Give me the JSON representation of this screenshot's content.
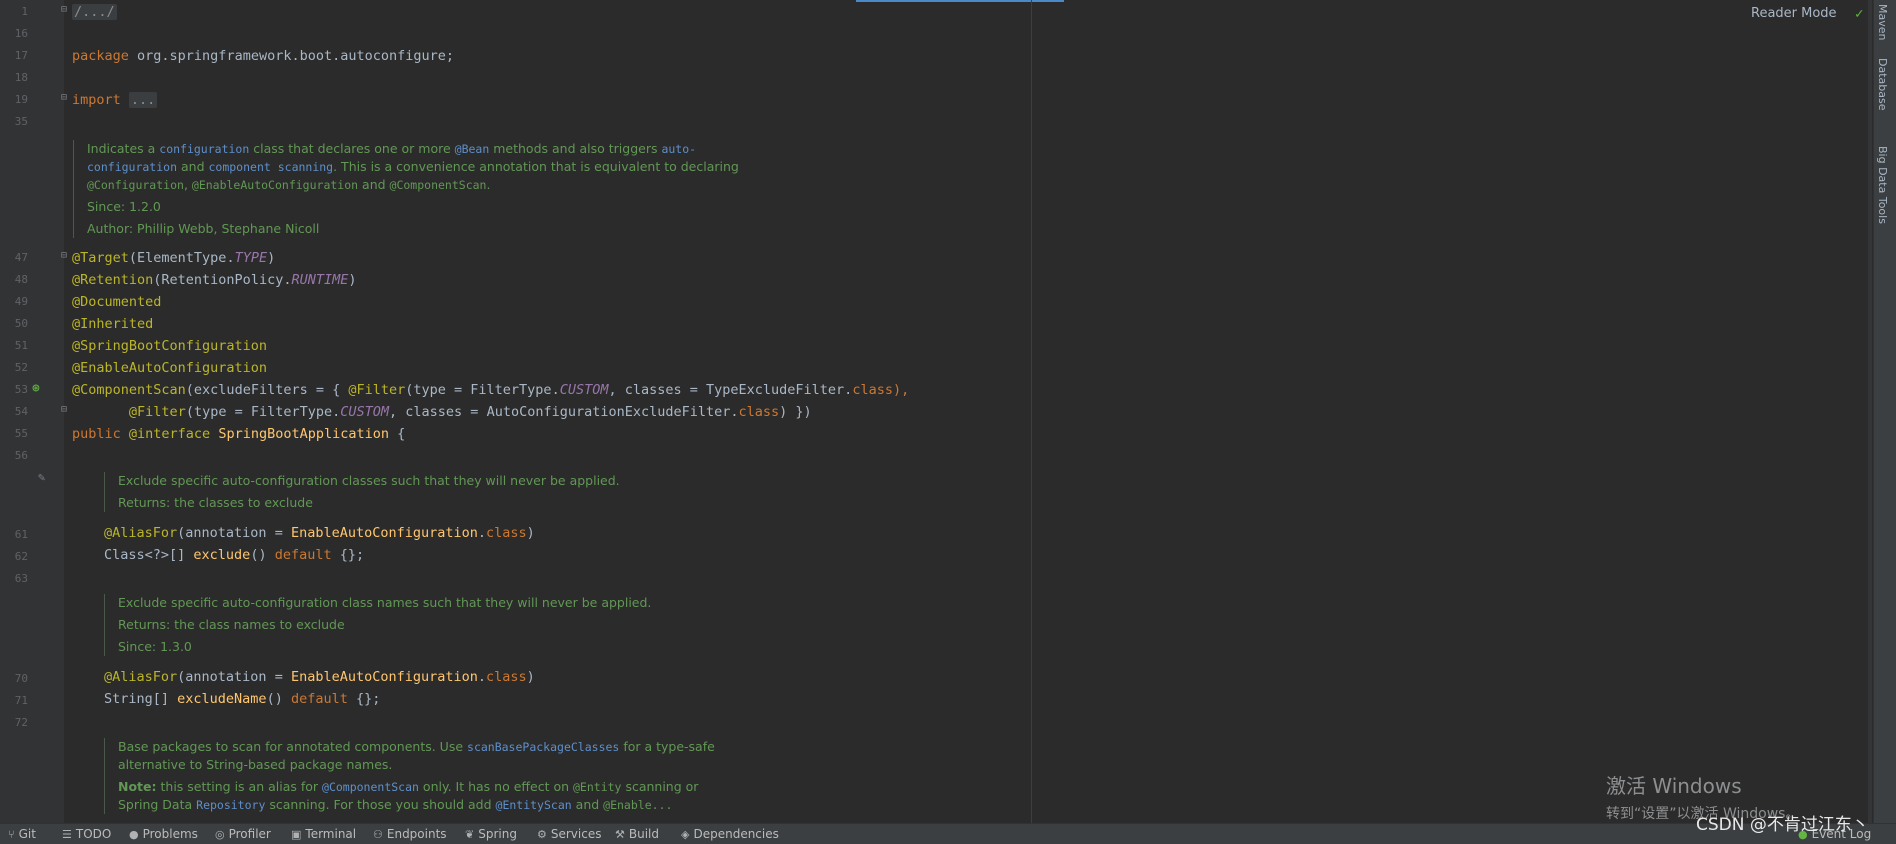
{
  "editor": {
    "reader_mode": "Reader Mode",
    "line_numbers": [
      "1",
      "16",
      "17",
      "18",
      "19",
      "35",
      "47",
      "48",
      "49",
      "50",
      "51",
      "52",
      "53",
      "54",
      "55",
      "56",
      "61",
      "62",
      "63",
      "70",
      "71",
      "72"
    ],
    "code": {
      "l1": "/.../",
      "l17_kw": "package",
      "l17_rest": " org.springframework.boot.autoconfigure;",
      "l19_kw": "import",
      "l19_fold": "...",
      "l47_an": "@Target",
      "l47_a": "(ElementType.",
      "l47_it": "TYPE",
      "l47_b": ")",
      "l48_an": "@Retention",
      "l48_a": "(RetentionPolicy.",
      "l48_it": "RUNTIME",
      "l48_b": ")",
      "l49_an": "@Documented",
      "l50_an": "@Inherited",
      "l51_an": "@SpringBootConfiguration",
      "l52_an": "@EnableAutoConfiguration",
      "l53_an": "@ComponentScan",
      "l53_a": "(excludeFilters = { ",
      "l53_an2": "@Filter",
      "l53_b": "(type = FilterType.",
      "l53_it": "CUSTOM",
      "l53_c": ", classes = TypeExcludeFilter.",
      "l53_kw": "class",
      "l53_d": "),",
      "l54_indent": "       ",
      "l54_an": "@Filter",
      "l54_a": "(type = FilterType.",
      "l54_it": "CUSTOM",
      "l54_b": ", classes = AutoConfigurationExcludeFilter.",
      "l54_kw": "class",
      "l54_c": ") })",
      "l55_kw": "public",
      "l55_an": " @interface",
      "l55_fn": " SpringBootApplication",
      "l55_rest": " {",
      "l61_an": "@AliasFor",
      "l61_a": "(annotation = ",
      "l61_fn": "EnableAutoConfiguration",
      "l61_b": ".",
      "l61_kw": "class",
      "l61_c": ")",
      "l62_a": "Class<?>[] ",
      "l62_fn": "exclude",
      "l62_b": "() ",
      "l62_kw": "default",
      "l62_c": " {};",
      "l70_an": "@AliasFor",
      "l70_a": "(annotation = ",
      "l70_fn": "EnableAutoConfiguration",
      "l70_b": ".",
      "l70_kw": "class",
      "l70_c": ")",
      "l71_a": "String[] ",
      "l71_fn": "excludeName",
      "l71_b": "() ",
      "l71_kw": "default",
      "l71_c": " {};"
    },
    "doc1": {
      "t1": "Indicates a ",
      "l1": "configuration",
      "t2": " class that declares one or more ",
      "l2": "@Bean",
      "t3": " methods and also triggers ",
      "l3a": "auto-",
      "l3b": "configuration",
      "t4": " and ",
      "l4": "component scanning",
      "t5": ". This is a convenience annotation that is equivalent to declaring",
      "c1": "@Configuration",
      "t6": ", ",
      "c2": "@EnableAutoConfiguration",
      "t7": " and ",
      "c3": "@ComponentScan",
      "t8": ".",
      "since": "Since:    1.2.0",
      "author": "Author: Phillip Webb, Stephane Nicoll"
    },
    "doc2": {
      "line1": "Exclude specific auto-configuration classes such that they will never be applied.",
      "line2": "Returns: the classes to exclude"
    },
    "doc3": {
      "line1": "Exclude specific auto-configuration class names such that they will never be applied.",
      "line2": "Returns: the class names to exclude",
      "line3": "Since:    1.3.0"
    },
    "doc4": {
      "t1": "Base packages to scan for annotated components. Use ",
      "l1": "scanBasePackageClasses",
      "t2": " for a type-safe",
      "t3": "alternative to String-based package names.",
      "note": "Note:",
      "t4": " this setting is an alias for ",
      "c1": "@ComponentScan",
      "t5": " only. It has no effect on ",
      "c2": "@Entity",
      "t6": " scanning or",
      "t7": "Spring Data ",
      "l2": "Repository",
      "t8": " scanning. For those you should add ",
      "c3": "@EntityScan",
      "t9": " and ",
      "c4": "@Enable...",
      "t10": ""
    }
  },
  "right_strip": [
    "Maven",
    "Database",
    "Big Data Tools"
  ],
  "statusbar": {
    "items": [
      "Git",
      "TODO",
      "Problems",
      "Profiler",
      "Terminal",
      "Endpoints",
      "Spring",
      "Services",
      "Build",
      "Dependencies"
    ],
    "event_log": "Event Log"
  },
  "watermark": {
    "title": "激活 Windows",
    "sub": "转到“设置”以激活 Windows。"
  },
  "csdn": "CSDN @不肯过江东丶",
  "colors": {
    "background": "#2b2b2b",
    "keyword": "#cc7832",
    "annotation": "#bbb529",
    "doc": "#629755",
    "link": "#5e8fca"
  }
}
